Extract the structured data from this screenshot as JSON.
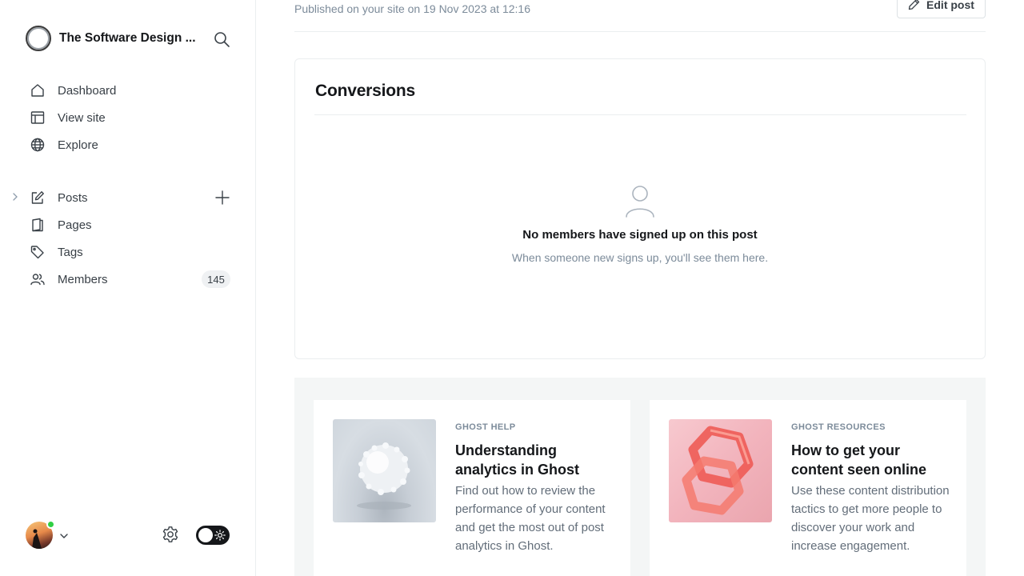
{
  "site": {
    "title": "The Software Design ...",
    "search_icon": "search-icon"
  },
  "nav": {
    "dashboard": "Dashboard",
    "view_site": "View site",
    "explore": "Explore",
    "posts": "Posts",
    "pages": "Pages",
    "tags": "Tags",
    "members": "Members",
    "members_count": "145"
  },
  "main": {
    "published_text": "Published on your site on 19 Nov 2023 at 12:16",
    "edit_label": "Edit post",
    "conversions": {
      "title": "Conversions",
      "empty_title": "No members have signed up on this post",
      "empty_sub": "When someone new signs up, you'll see them here."
    },
    "resources": [
      {
        "tag": "GHOST HELP",
        "title": "Understanding analytics in Ghost",
        "desc": "Find out how to review the performance of your content and get the most out of post analytics in Ghost."
      },
      {
        "tag": "GHOST RESOURCES",
        "title": "How to get your content seen online",
        "desc": "Use these content distribution tactics to get more people to discover your work and increase engagement."
      }
    ]
  },
  "colors": {
    "accent": "#30cf43",
    "text": "#15171a",
    "muted": "#7c8b9a",
    "toggle": "#15171a"
  }
}
